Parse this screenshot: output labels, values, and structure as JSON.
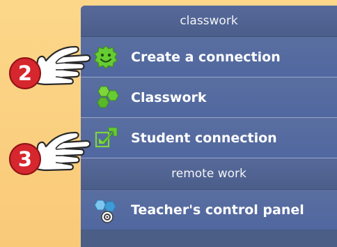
{
  "menu": {
    "sections": [
      {
        "header": "classwork"
      },
      {
        "header": "remote work"
      }
    ],
    "items": [
      {
        "label": "Create a connection",
        "icon": "green-smiley-icon"
      },
      {
        "label": "Classwork",
        "icon": "green-hexagons-icon"
      },
      {
        "label": "Student connection",
        "icon": "green-arrow-connect-icon"
      },
      {
        "label": "Teacher's control panel",
        "icon": "blue-hexagons-gear-icon"
      }
    ]
  },
  "callouts": [
    {
      "number": "2",
      "target": "Create a connection"
    },
    {
      "number": "3",
      "target": "Student connection"
    }
  ],
  "colors": {
    "panel": "#4a5e86",
    "item": "#5a6fa0",
    "badge": "#d6262e",
    "background": "#fcd78a",
    "icon_green": "#66cc33",
    "icon_blue": "#3d9bd6"
  }
}
